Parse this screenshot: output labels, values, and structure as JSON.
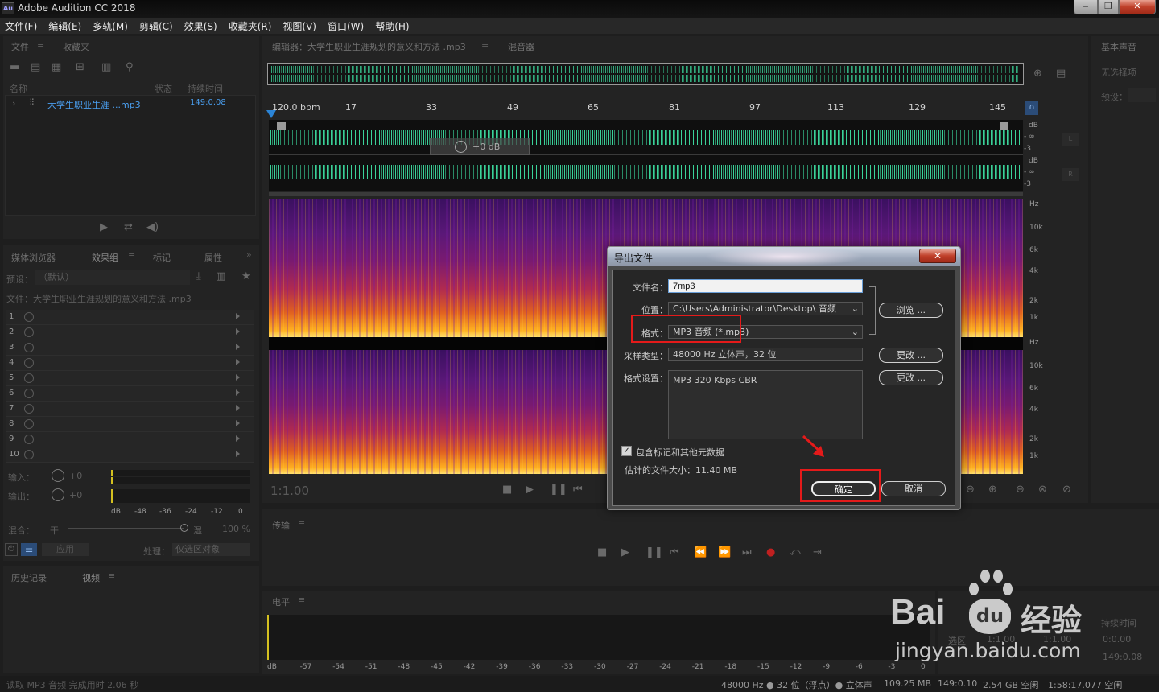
{
  "titlebar": {
    "app_icon": "Au",
    "title": "Adobe Audition CC 2018",
    "min": "‒",
    "max": "❐",
    "close": "✕"
  },
  "menu": [
    "文件(F)",
    "编辑(E)",
    "多轨(M)",
    "剪辑(C)",
    "效果(S)",
    "收藏夹(R)",
    "视图(V)",
    "窗口(W)",
    "帮助(H)"
  ],
  "files_panel": {
    "tab_files": "文件",
    "tab_fav": "收藏夹",
    "col_name": "名称",
    "col_status": "状态",
    "col_duration": "持续时间",
    "file_name": "大学生职业生涯 ...mp3",
    "file_duration": "149:0.08"
  },
  "effects_panel": {
    "tab_media": "媒体浏览器",
    "tab_effects": "效果组",
    "tab_markers": "标记",
    "tab_props": "属性",
    "preset_label": "预设：",
    "preset_value": "（默认）",
    "file_label": "文件：大学生职业生涯规划的意义和方法 .mp3",
    "rows": [
      "1",
      "2",
      "3",
      "4",
      "5",
      "6",
      "7",
      "8",
      "9",
      "10"
    ],
    "input_label": "输入：",
    "input_val": "+0",
    "output_label": "输出：",
    "output_val": "+0",
    "meter_ticks": [
      "dB",
      "-48",
      "-36",
      "-24",
      "-12",
      "0"
    ],
    "mix_label": "混合：",
    "mix_dry": "干",
    "mix_wet": "湿",
    "mix_pct": "100 %",
    "apply": "应用",
    "process_label": "处理：",
    "process_value": "仅选区对象"
  },
  "history_panel": {
    "tab_history": "历史记录",
    "tab_video": "视频"
  },
  "editor": {
    "tab_editor": "编辑器：大学生职业生涯规划的意义和方法 .mp3",
    "tab_mixer": "混音器",
    "bpm": "120.0 bpm",
    "ruler": [
      "17",
      "33",
      "49",
      "65",
      "81",
      "97",
      "113",
      "129",
      "145"
    ],
    "hud_db": "+0 dB",
    "db_top": [
      "dB",
      "- ∞",
      "-3"
    ],
    "db_bot": [
      "dB",
      "- ∞",
      "-3"
    ],
    "ch_l": "L",
    "ch_r": "R",
    "hz_top": [
      "Hz",
      "10k",
      "6k",
      "4k",
      "2k",
      "1k"
    ],
    "hz_bot": [
      "Hz",
      "10k",
      "6k",
      "4k",
      "2k",
      "1k"
    ],
    "timecode": "1:1.00"
  },
  "right_panel": {
    "basic_sound": "基本声音",
    "no_selection": "无选择项",
    "preset": "预设："
  },
  "transport_panel": {
    "title": "传输"
  },
  "levels_panel": {
    "title": "电平",
    "ticks": [
      "dB",
      "-57",
      "-54",
      "-51",
      "-48",
      "-45",
      "-42",
      "-39",
      "-36",
      "-33",
      "-30",
      "-27",
      "-24",
      "-21",
      "-18",
      "-15",
      "-12",
      "-9",
      "-6",
      "-3",
      "0"
    ]
  },
  "selection_panel": {
    "sel": "选区",
    "start": "1:1.00",
    "end": "1:1.00",
    "duration_label": "持续时间",
    "duration": "0:0.00",
    "dur2": "149:0.08"
  },
  "dialog": {
    "title": "导出文件",
    "close": "✕",
    "filename_label": "文件名：",
    "filename": "7mp3",
    "location_label": "位置：",
    "location": "C:\\Users\\Administrator\\Desktop\\ 音频",
    "browse": "浏览 ...",
    "format_label": "格式：",
    "format": "MP3 音频 (*.mp3)",
    "sample_label": "采样类型：",
    "sample": "48000 Hz 立体声，32 位",
    "change1": "更改 ...",
    "settings_label": "格式设置：",
    "settings": "MP3 320 Kbps CBR",
    "change2": "更改 ...",
    "include_markers": "包含标记和其他元数据",
    "est_size": "估计的文件大小：11.40 MB",
    "ok": "确定",
    "cancel": "取消"
  },
  "status": {
    "left": "读取 MP3 音频 完成用时 2.06 秒",
    "rate": "48000 Hz ● 32 位（浮点）● 立体声",
    "mem": "109.25 MB",
    "dur": "149:0.10",
    "disk": "2.54 GB 空闲",
    "free": "1:58:17.077 空闲"
  },
  "watermark": {
    "brand": "Bai",
    "du": "du",
    "cn": "经验",
    "url": "jingyan.baidu.com"
  },
  "colors": {
    "accent": "#2b84d6",
    "wave": "#3cdca0",
    "highlight": "#e41a1a"
  }
}
